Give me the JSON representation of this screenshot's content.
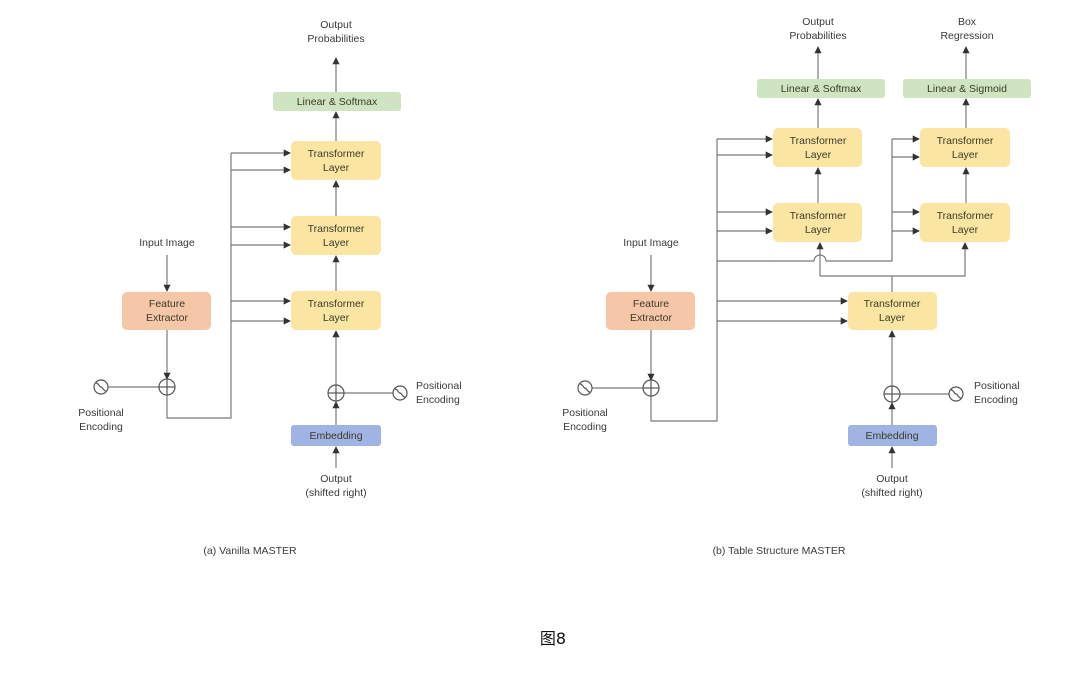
{
  "figure_label": "图8",
  "colors": {
    "transformer": "#fbe5a3",
    "linear": "#cfe4c0",
    "feature": "#f5c6a8",
    "embedding": "#9fb4e2",
    "wire": "#7a7a7a"
  },
  "panel_a": {
    "caption": "(a) Vanilla MASTER",
    "output_label": [
      "Output",
      "Probabilities"
    ],
    "linear_label": "Linear & Softmax",
    "transformer_layers": [
      [
        "Transformer",
        "Layer"
      ],
      [
        "Transformer",
        "Layer"
      ],
      [
        "Transformer",
        "Layer"
      ]
    ],
    "input_image_label": "Input Image",
    "feature_extractor": [
      "Feature",
      "Extractor"
    ],
    "pos_enc_left": [
      "Positional",
      "Encoding"
    ],
    "pos_enc_right": [
      "Positional",
      "Encoding"
    ],
    "embedding_label": "Embedding",
    "decoder_input": [
      "Output",
      "(shifted right)"
    ]
  },
  "panel_b": {
    "caption": "(b) Table Structure MASTER",
    "output_label": [
      "Output",
      "Probabilities"
    ],
    "box_label": [
      "Box",
      "Regression"
    ],
    "linear_softmax_label": "Linear & Softmax",
    "linear_sigmoid_label": "Linear & Sigmoid",
    "transformer_layers_left": [
      [
        "Transformer",
        "Layer"
      ],
      [
        "Transformer",
        "Layer"
      ]
    ],
    "transformer_layers_right": [
      [
        "Transformer",
        "Layer"
      ],
      [
        "Transformer",
        "Layer"
      ]
    ],
    "shared_transformer": [
      "Transformer",
      "Layer"
    ],
    "input_image_label": "Input Image",
    "feature_extractor": [
      "Feature",
      "Extractor"
    ],
    "pos_enc_left": [
      "Positional",
      "Encoding"
    ],
    "pos_enc_right": [
      "Positional",
      "Encoding"
    ],
    "embedding_label": "Embedding",
    "decoder_input": [
      "Output",
      "(shifted right)"
    ]
  }
}
